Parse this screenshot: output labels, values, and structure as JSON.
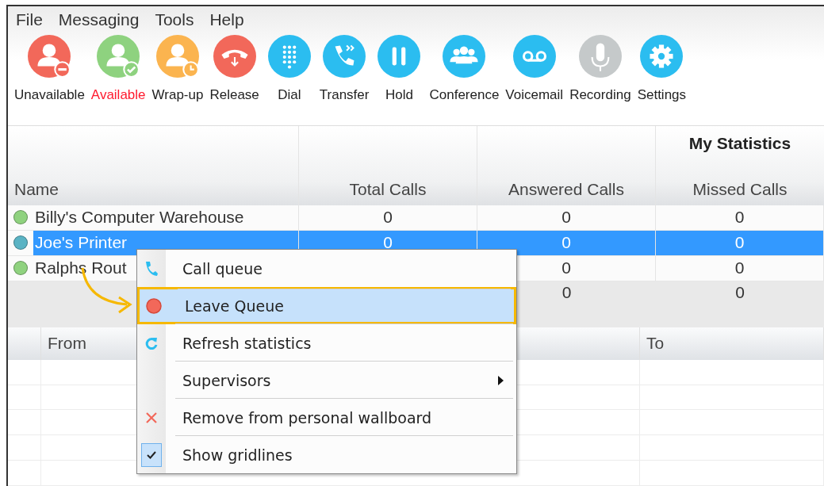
{
  "menu_bar": [
    "File",
    "Messaging",
    "Tools",
    "Help"
  ],
  "toolbar": [
    {
      "label": "Unavailable",
      "kind": "person-minus",
      "active": false
    },
    {
      "label": "Available",
      "kind": "person-check",
      "active": true
    },
    {
      "label": "Wrap-up",
      "kind": "person-clock",
      "active": false
    },
    {
      "label": "Release",
      "kind": "hangup",
      "active": false
    },
    {
      "label": "Dial",
      "kind": "dialpad",
      "active": false
    },
    {
      "label": "Transfer",
      "kind": "transfer",
      "active": false
    },
    {
      "label": "Hold",
      "kind": "pause",
      "active": false
    },
    {
      "label": "Conference",
      "kind": "group",
      "active": false
    },
    {
      "label": "Voicemail",
      "kind": "voicemail",
      "active": false
    },
    {
      "label": "Recording",
      "kind": "microphone",
      "active": false
    },
    {
      "label": "Settings",
      "kind": "gear",
      "active": false
    }
  ],
  "stats_table": {
    "group_heading": "My Statistics",
    "columns": [
      "Name",
      "Total Calls",
      "Answered Calls",
      "Missed Calls"
    ],
    "rows": [
      {
        "color": "#8fd27f",
        "name": "Billy's Computer Warehouse",
        "total_calls": "0",
        "answered_calls": "0",
        "missed_calls": "0",
        "selected": false
      },
      {
        "color": "#5ab3c4",
        "name": "Joe's Printer",
        "total_calls": "0",
        "answered_calls": "0",
        "missed_calls": "0",
        "selected": true
      },
      {
        "color": "#8fd27f",
        "name": "Ralphs Rout",
        "answered_calls": "0",
        "missed_calls": "0",
        "selected": false
      }
    ],
    "totals": {
      "answered_calls": "0",
      "missed_calls": "0"
    }
  },
  "calls_table": {
    "columns": [
      "From",
      "To"
    ]
  },
  "context_menu": [
    {
      "label": "Call queue",
      "kind": "phone",
      "selected": false,
      "checked": false,
      "submenu": false
    },
    {
      "label": "Leave Queue",
      "kind": "dot",
      "selected": true,
      "checked": false,
      "submenu": false
    },
    {
      "label": "Refresh statistics",
      "kind": "refresh",
      "selected": false,
      "checked": false,
      "submenu": false
    },
    {
      "label": "Supervisors",
      "kind": "plain",
      "selected": false,
      "checked": false,
      "submenu": true
    },
    {
      "label": "Remove from personal wallboard",
      "kind": "cross",
      "selected": false,
      "checked": false,
      "submenu": false
    },
    {
      "label": "Show gridlines",
      "kind": "plain",
      "selected": false,
      "checked": true,
      "submenu": false
    }
  ]
}
